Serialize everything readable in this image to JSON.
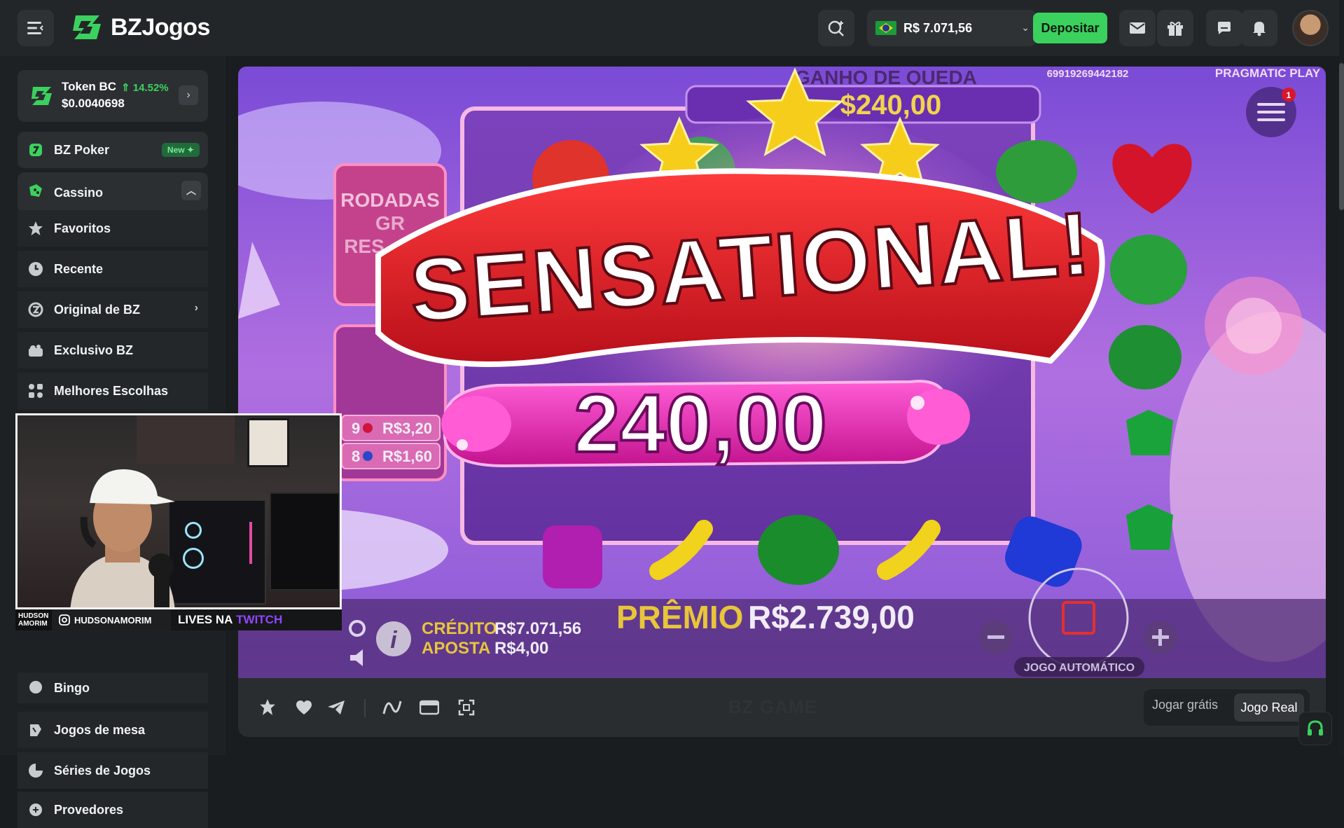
{
  "header": {
    "brand": "BZJogos",
    "balance": "R$ 7.071,56",
    "deposit_label": "Depositar",
    "icons": [
      "menu-icon",
      "search-icon",
      "mail-icon",
      "gift-icon",
      "chat-icon",
      "bell-icon"
    ]
  },
  "sidebar": {
    "token": {
      "name": "Token BC",
      "change": "14.52%",
      "price": "$0.0040698"
    },
    "items": [
      {
        "label": "BZ Poker",
        "badge": "New",
        "icon": "poker-icon"
      },
      {
        "label": "Cassino",
        "icon": "casino-icon"
      },
      {
        "label": "Favoritos",
        "icon": "star-icon"
      },
      {
        "label": "Recente",
        "icon": "clock-icon"
      },
      {
        "label": "Original de BZ",
        "icon": "original-icon"
      },
      {
        "label": "Exclusivo BZ",
        "icon": "exclusive-icon"
      },
      {
        "label": "Melhores Escolhas",
        "icon": "grid-icon"
      },
      {
        "label": "Bingo",
        "icon": "bingo-icon"
      },
      {
        "label": "Jogos de mesa",
        "icon": "table-games-icon"
      },
      {
        "label": "Séries de Jogos",
        "icon": "series-icon"
      },
      {
        "label": "Provedores",
        "icon": "providers-icon"
      }
    ]
  },
  "stream": {
    "name_tag": "HUDSON AMORIM",
    "handle": "HUDSONAMORIM",
    "lives": "LIVES NA",
    "platform": "TWITCH"
  },
  "game": {
    "drop_win_label": "GANHO DE QUEDA",
    "drop_win_value": "$240,00",
    "round_id": "69919269442182",
    "provider": "PRAGMATIC PLAY",
    "free_spins_label_1": "RODADAS",
    "free_spins_label_2": "GR",
    "free_spins_label_3": "RES",
    "banner": "SENSATIONAL!",
    "win_amount": "240,00",
    "paytable": [
      {
        "count": "9",
        "value": "R$3,20"
      },
      {
        "count": "8",
        "value": "R$1,60"
      }
    ],
    "credit_label": "CRÉDITO",
    "credit_value": "R$7.071,56",
    "bet_label": "APOSTA",
    "bet_value": "R$4,00",
    "prize_label": "PRÊMIO",
    "prize_value": "R$2.739,00",
    "autoplay_label": "JOGO AUTOMÁTICO",
    "menu_badge": "1",
    "watermark": "BZ GAME"
  },
  "toolbar": {
    "free_label": "Jogar grátis",
    "real_label": "Jogo Real"
  },
  "colors": {
    "accent": "#3bd15e",
    "background": "#1a1d1f",
    "panel": "#2b2f32"
  }
}
